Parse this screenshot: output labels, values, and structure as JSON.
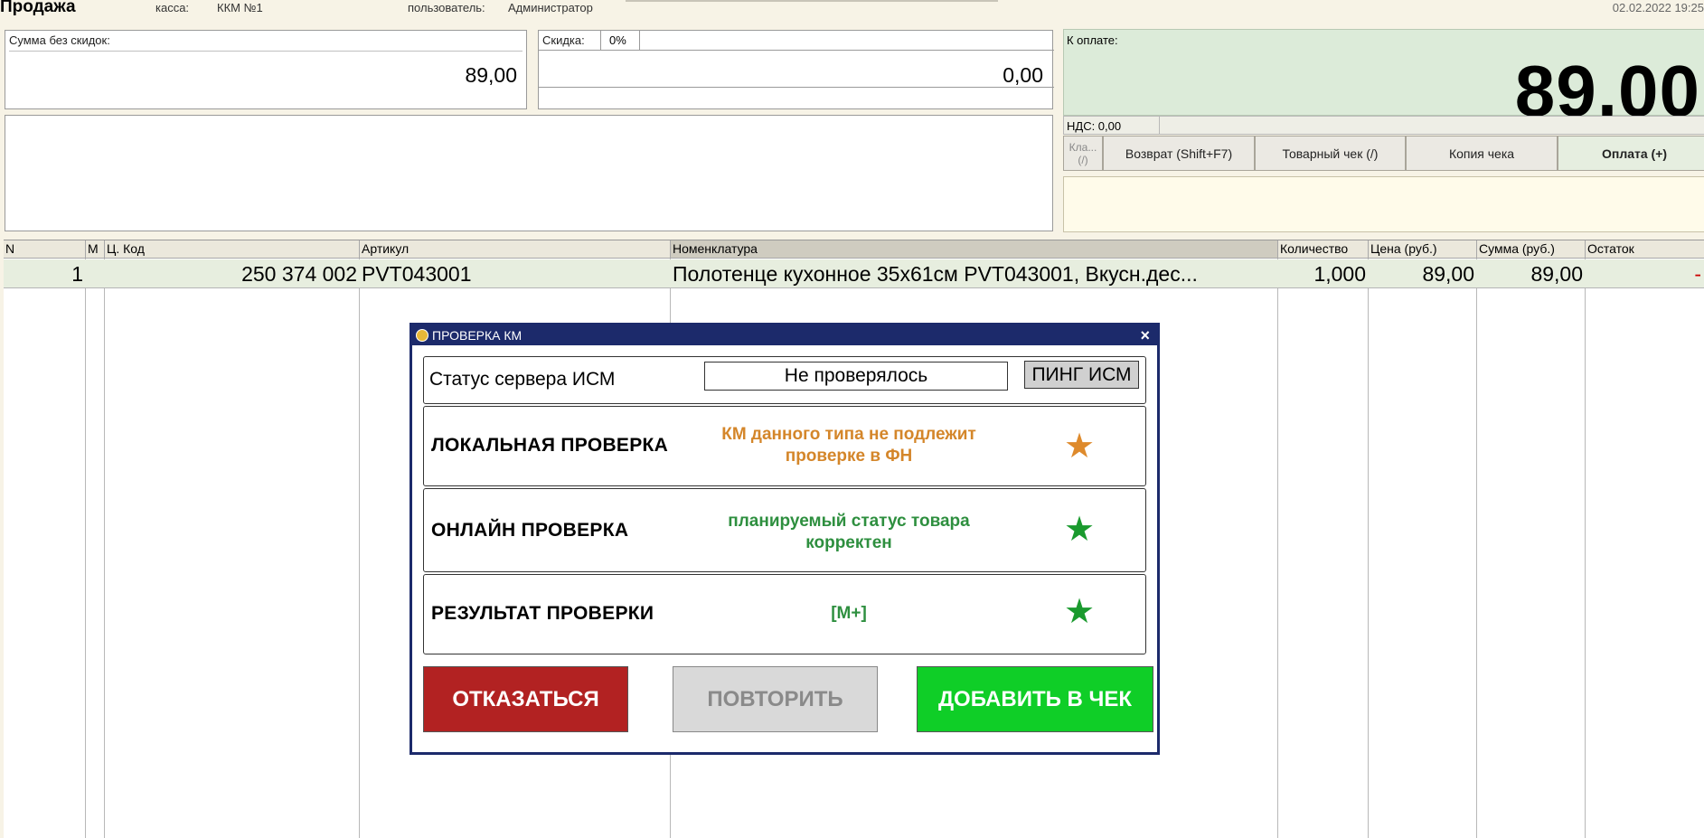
{
  "header": {
    "title": "Продажа",
    "kassa_label": "касса:",
    "kassa_value": "ККМ №1",
    "user_label": "пользователь:",
    "user_value": "Администратор",
    "datetime": "02.02.2022 19:25"
  },
  "sum_panel": {
    "label": "Сумма без скидок:",
    "value": "89,00"
  },
  "discount_panel": {
    "label": "Скидка:",
    "percent": "0%",
    "value": "0,00"
  },
  "payment": {
    "label": "К оплате:",
    "amount": "89,00",
    "vat_label": "НДС: 0,00"
  },
  "buttons": {
    "keyboard": "Кла... (/)",
    "return": "Возврат (Shift+F7)",
    "receipt": "Товарный чек (/)",
    "copy": "Копия чека",
    "pay": "Оплата (+)"
  },
  "table": {
    "columns": [
      "N",
      "М",
      "Ц. Код",
      "Артикул",
      "Номенклатура",
      "Количество",
      "Цена (руб.)",
      "Сумма (руб.)",
      "Остаток"
    ],
    "rows": [
      {
        "n": "1",
        "code": "250 374 002",
        "article": "PVT043001",
        "name": "Полотенце кухонное 35х61см PVT043001, Вкусн.дес...",
        "qty": "1,000",
        "price": "89,00",
        "sum": "89,00",
        "remainder": "-"
      }
    ]
  },
  "dialog": {
    "title": "ПРОВЕРКА КМ",
    "server_label": "Статус сервера ИСМ",
    "server_status": "Не проверялось",
    "ping_button": "ПИНГ ИСМ",
    "local_label": "ЛОКАЛЬНАЯ ПРОВЕРКА",
    "local_msg": "КМ данного типа не подлежит проверке в ФН",
    "online_label": "ОНЛАЙН ПРОВЕРКА",
    "online_msg": "планируемый статус товара корректен",
    "result_label": "РЕЗУЛЬТАТ ПРОВЕРКИ",
    "result_msg": "[М+]",
    "cancel_button": "ОТКАЗАТЬСЯ",
    "retry_button": "ПОВТОРИТЬ",
    "add_button": "ДОБАВИТЬ В ЧЕК",
    "colors": {
      "warning": "#d4862a",
      "ok": "#2e8f3f",
      "star_ok": "#1a9a2e",
      "cancel": "#b22222",
      "add": "#0fce27",
      "retry": "#d9d9d9"
    }
  }
}
